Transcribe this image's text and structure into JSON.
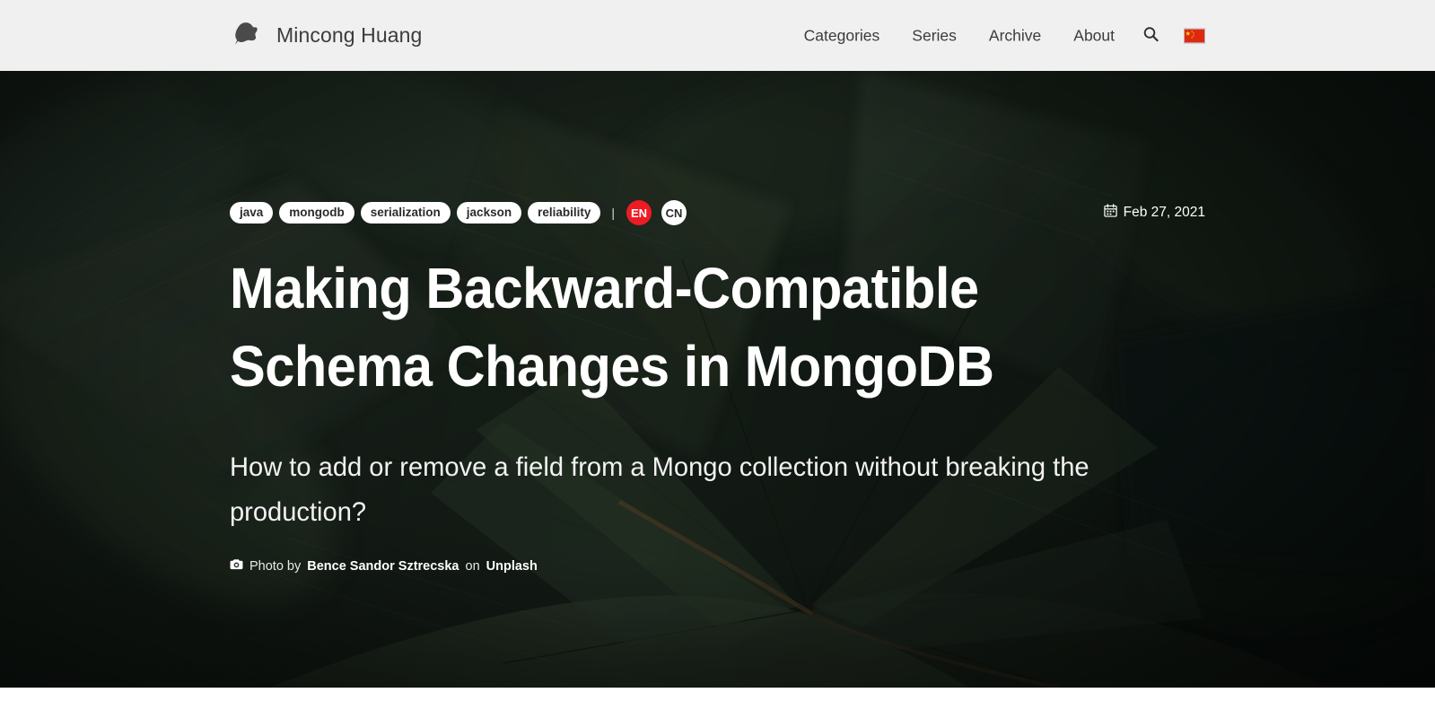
{
  "header": {
    "brand": {
      "name": "Mincong Huang",
      "logo_icon": "ink-blob-logo-icon"
    },
    "nav": [
      {
        "label": "Categories"
      },
      {
        "label": "Series"
      },
      {
        "label": "Archive"
      },
      {
        "label": "About"
      }
    ],
    "search_icon": "search-icon",
    "language_flag": {
      "icon": "china-flag-icon",
      "label": "中文"
    }
  },
  "hero": {
    "tags": [
      {
        "label": "java"
      },
      {
        "label": "mongodb"
      },
      {
        "label": "serialization"
      },
      {
        "label": "jackson"
      },
      {
        "label": "reliability"
      }
    ],
    "lang_separator": "|",
    "languages": [
      {
        "label": "EN",
        "active": true
      },
      {
        "label": "CN",
        "active": false
      }
    ],
    "date": {
      "icon": "calendar-icon",
      "text": "Feb 27, 2021"
    },
    "title": "Making Backward-Compatible Schema Changes in MongoDB",
    "subtitle": "How to add or remove a field from a Mongo collection without breaking the production?",
    "photo_credit": {
      "icon": "camera-icon",
      "prefix": "Photo by",
      "author": "Bence Sandor Sztrecska",
      "middle": "on",
      "source": "Unplash"
    }
  },
  "colors": {
    "header_bg": "#f0f0f0",
    "accent_red": "#ed1b24",
    "text_dark": "#3c3c3c",
    "hero_dark": "#1d241f"
  }
}
